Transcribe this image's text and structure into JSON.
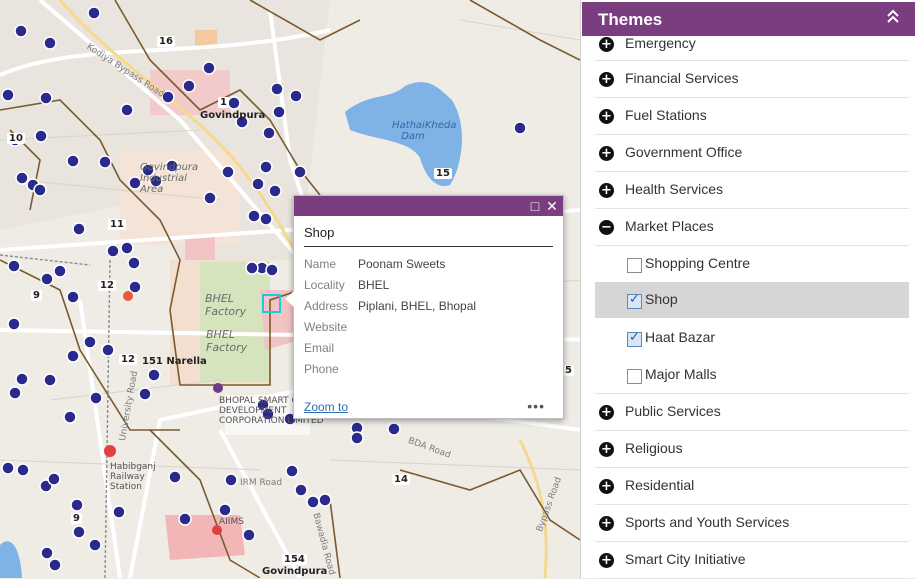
{
  "map": {
    "labels": {
      "bypass_road": "Kodiya Bypass Road",
      "govindpura_top": "Govindpura",
      "govindpura_industrial": "Govindpura Industrial Area",
      "hathaikheda_dam": "HathaiKheda Dam",
      "bhel_factory_1": "BHEL Factory",
      "bhel_factory_2": "BHEL Factory",
      "narella": "151 Narella",
      "smart_city": "BHOPAL SMART CITY DEVELOPMENT CORPORATION LIMITED",
      "bda_road": "BDA Road",
      "irm_road": "IRM Road",
      "university_road": "University Road",
      "habibganj": "Habibganj Railway Station",
      "aiims": "AIIMS",
      "govindpura_bottom": "Govindpura",
      "bypass_road_2": "Bypass Road",
      "bawadia": "Bawadia Road",
      "n16": "16",
      "n1": "1",
      "n10": "10",
      "n11": "11",
      "n15": "15",
      "n12": "12",
      "n12b": "12",
      "n9": "9",
      "n9b": "9",
      "n14": "14",
      "n154": "154",
      "n5": "5"
    }
  },
  "popup": {
    "title": "Shop",
    "fields": [
      {
        "key": "Name",
        "value": "Poonam Sweets"
      },
      {
        "key": "Locality",
        "value": "BHEL"
      },
      {
        "key": "Address",
        "value": "Piplani, BHEL, Bhopal"
      },
      {
        "key": "Website",
        "value": ""
      },
      {
        "key": "Email",
        "value": ""
      },
      {
        "key": "Phone",
        "value": ""
      }
    ],
    "zoom_label": "Zoom to",
    "more_label": "•••",
    "maximize_icon": "□",
    "close_icon": "✕"
  },
  "themes": {
    "title": "Themes",
    "collapse_icon": "⌃⌃",
    "items": [
      {
        "label": "Emergency",
        "expanded": false
      },
      {
        "label": "Financial Services",
        "expanded": false
      },
      {
        "label": "Fuel Stations",
        "expanded": false
      },
      {
        "label": "Government Office",
        "expanded": false
      },
      {
        "label": "Health Services",
        "expanded": false
      },
      {
        "label": "Market Places",
        "expanded": true
      },
      {
        "label": "Public Services",
        "expanded": false
      },
      {
        "label": "Religious",
        "expanded": false
      },
      {
        "label": "Residential",
        "expanded": false
      },
      {
        "label": "Sports and Youth Services",
        "expanded": false
      },
      {
        "label": "Smart City Initiative",
        "expanded": false
      }
    ],
    "sub_items": [
      {
        "label": "Shopping Centre",
        "checked": false
      },
      {
        "label": "Shop",
        "checked": true,
        "selected": true
      },
      {
        "label": "Haat Bazar",
        "checked": true
      },
      {
        "label": "Major Malls",
        "checked": false
      }
    ],
    "plus": "+",
    "minus": "−"
  },
  "colors": {
    "accent": "#7a3d7f",
    "water": "#7fb2e5",
    "bus_marker": "#2a2a8c",
    "boundary": "#7a5a2e"
  }
}
